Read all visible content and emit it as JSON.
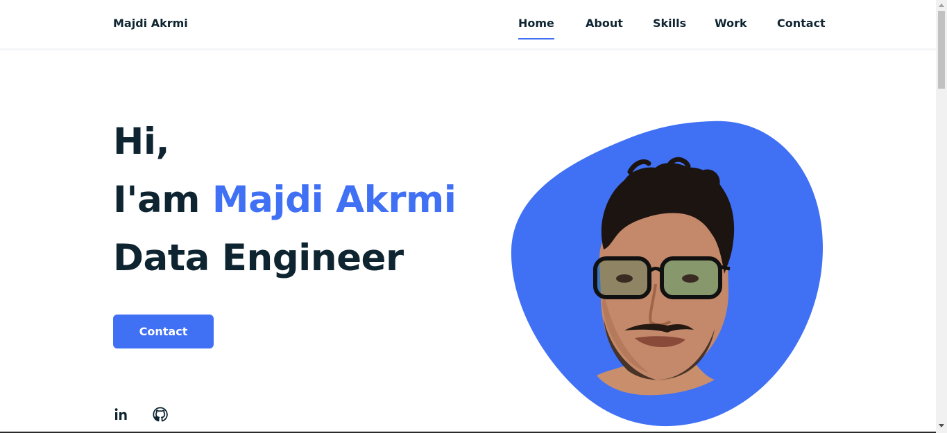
{
  "header": {
    "logo": "Majdi Akrmi",
    "nav": [
      {
        "label": "Home",
        "active": true
      },
      {
        "label": "About",
        "active": false
      },
      {
        "label": "Skills",
        "active": false
      },
      {
        "label": "Work",
        "active": false
      },
      {
        "label": "Contact",
        "active": false
      }
    ]
  },
  "hero": {
    "greeting": "Hi,",
    "intro_prefix": "I'am",
    "name": "Majdi Akrmi",
    "role": "Data Engineer",
    "contact_button": "Contact"
  },
  "social": [
    {
      "icon": "linkedin-icon",
      "label": "in"
    },
    {
      "icon": "github-icon"
    }
  ],
  "colors": {
    "accent": "#4070f4",
    "text": "#0e2431",
    "background": "#ffffff"
  }
}
